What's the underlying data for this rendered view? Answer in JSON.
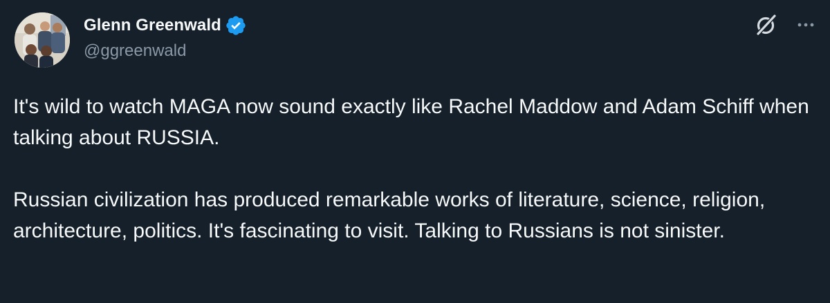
{
  "author": {
    "display_name": "Glenn Greenwald",
    "handle": "@ggreenwald",
    "verified": true
  },
  "icons": {
    "grok": "grok-icon",
    "more": "more-icon",
    "verified": "verified-badge-icon"
  },
  "tweet": {
    "paragraphs": [
      "It's wild to watch MAGA now sound exactly like Rachel Maddow and Adam Schiff when talking about RUSSIA.",
      "Russian civilization has produced remarkable works of literature, science, religion, architecture, politics. It's fascinating to visit. Talking to Russians is not sinister."
    ]
  },
  "colors": {
    "background": "#15202b",
    "text": "#f7f9f9",
    "secondary_text": "#8b98a5",
    "verified_blue": "#1d9bf0"
  }
}
